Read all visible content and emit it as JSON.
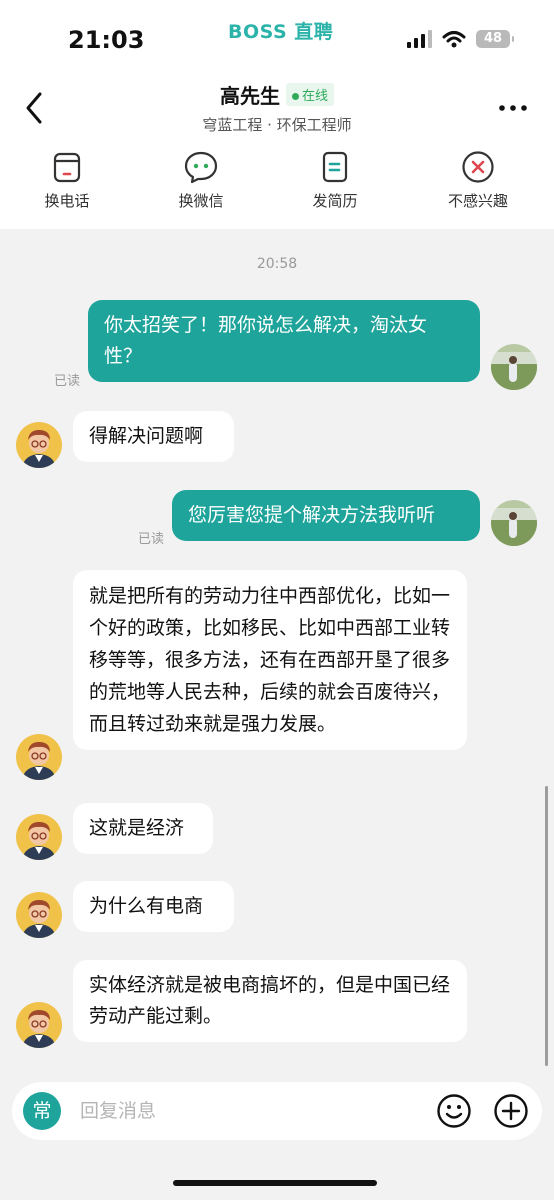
{
  "status_bar": {
    "time": "21:03",
    "brand": "BOSS 直聘",
    "battery": "48"
  },
  "header": {
    "name": "高先生",
    "online_label": "在线",
    "subtitle": "穹蓝工程 · 环保工程师"
  },
  "actions": [
    {
      "label": "换电话",
      "icon": "phone-swap-icon"
    },
    {
      "label": "换微信",
      "icon": "wechat-icon"
    },
    {
      "label": "发简历",
      "icon": "resume-icon"
    },
    {
      "label": "不感兴趣",
      "icon": "not-interested-icon"
    }
  ],
  "chat": {
    "timestamp": "20:58",
    "read_label": "已读",
    "messages": [
      {
        "from": "me",
        "text": "你太招笑了！那你说怎么解决，淘汰女性？",
        "status": "已读"
      },
      {
        "from": "them",
        "text": "得解决问题啊"
      },
      {
        "from": "me",
        "text": "您厉害您提个解决方法我听听",
        "status": "已读"
      },
      {
        "from": "them",
        "text": "就是把所有的劳动力往中西部优化，比如一个好的政策，比如移民、比如中西部工业转移等等，很多方法，还有在西部开垦了很多的荒地等人民去种，后续的就会百废待兴，而且转过劲来就是强力发展。"
      },
      {
        "from": "them",
        "text": "这就是经济"
      },
      {
        "from": "them",
        "text": "为什么有电商"
      },
      {
        "from": "them",
        "text": "实体经济就是被电商搞坏的，但是中国已经劳动产能过剩。"
      }
    ]
  },
  "input": {
    "common_label": "常",
    "placeholder": "回复消息"
  },
  "colors": {
    "accent": "#1fa49b",
    "brand": "#2bb3a9",
    "online": "#2faa5a",
    "reject": "#e0464f"
  }
}
